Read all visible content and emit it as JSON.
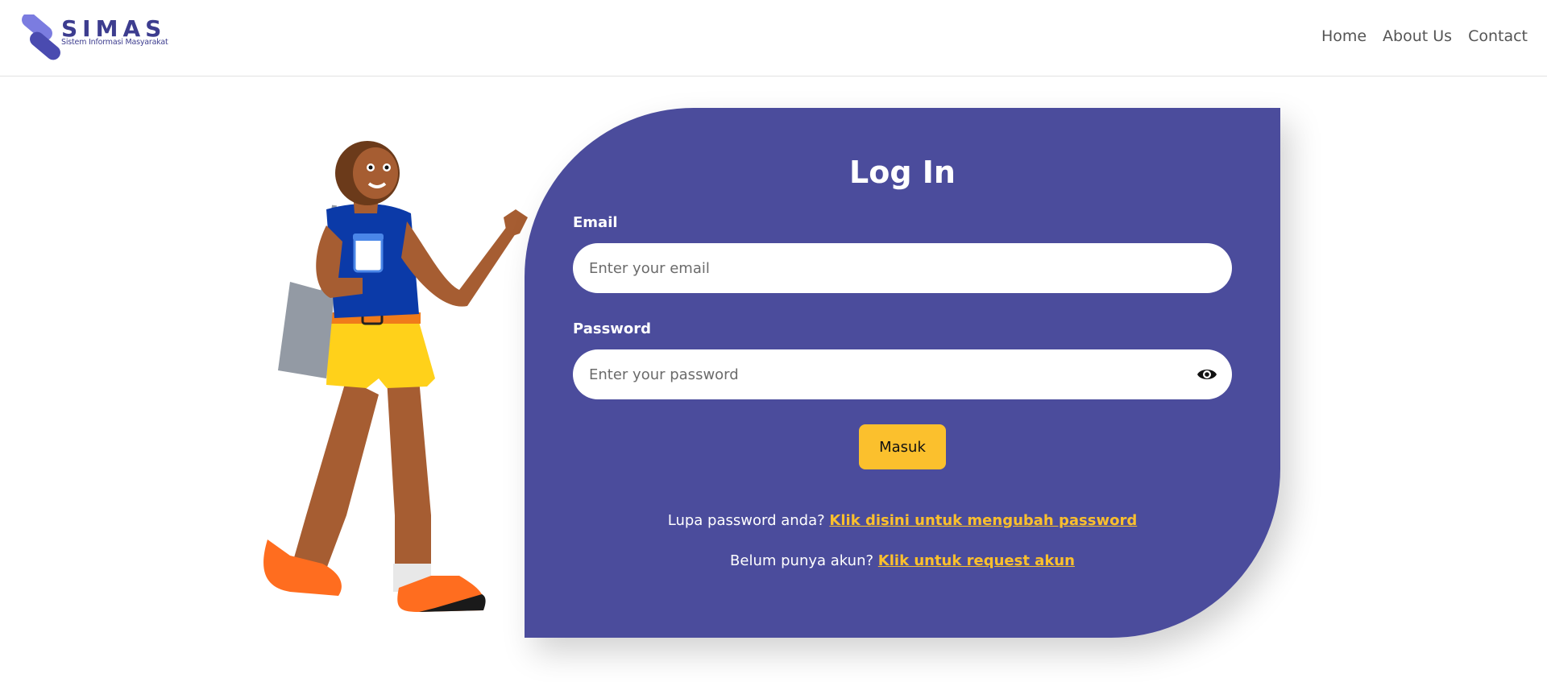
{
  "brand": {
    "title": "SIMAS",
    "subtitle": "Sistem Informasi Masyarakat",
    "accent_color": "#3d3d8f",
    "logo_icon": "chain-link-icon"
  },
  "nav": {
    "items": [
      {
        "label": "Home"
      },
      {
        "label": "About Us"
      },
      {
        "label": "Contact"
      }
    ]
  },
  "illustration": {
    "icon": "woman-walking-illustration"
  },
  "login": {
    "title": "Log In",
    "card_color": "#4b4c9c",
    "email": {
      "label": "Email",
      "placeholder": "Enter your email",
      "value": ""
    },
    "password": {
      "label": "Password",
      "placeholder": "Enter your password",
      "value": "",
      "toggle_icon": "eye-icon"
    },
    "submit_label": "Masuk",
    "submit_color": "#fbc02d",
    "forgot": {
      "text": "Lupa password anda?",
      "link": "Klik disini untuk mengubah password"
    },
    "register": {
      "text": "Belum punya akun?",
      "link": "Klik untuk request akun"
    }
  }
}
